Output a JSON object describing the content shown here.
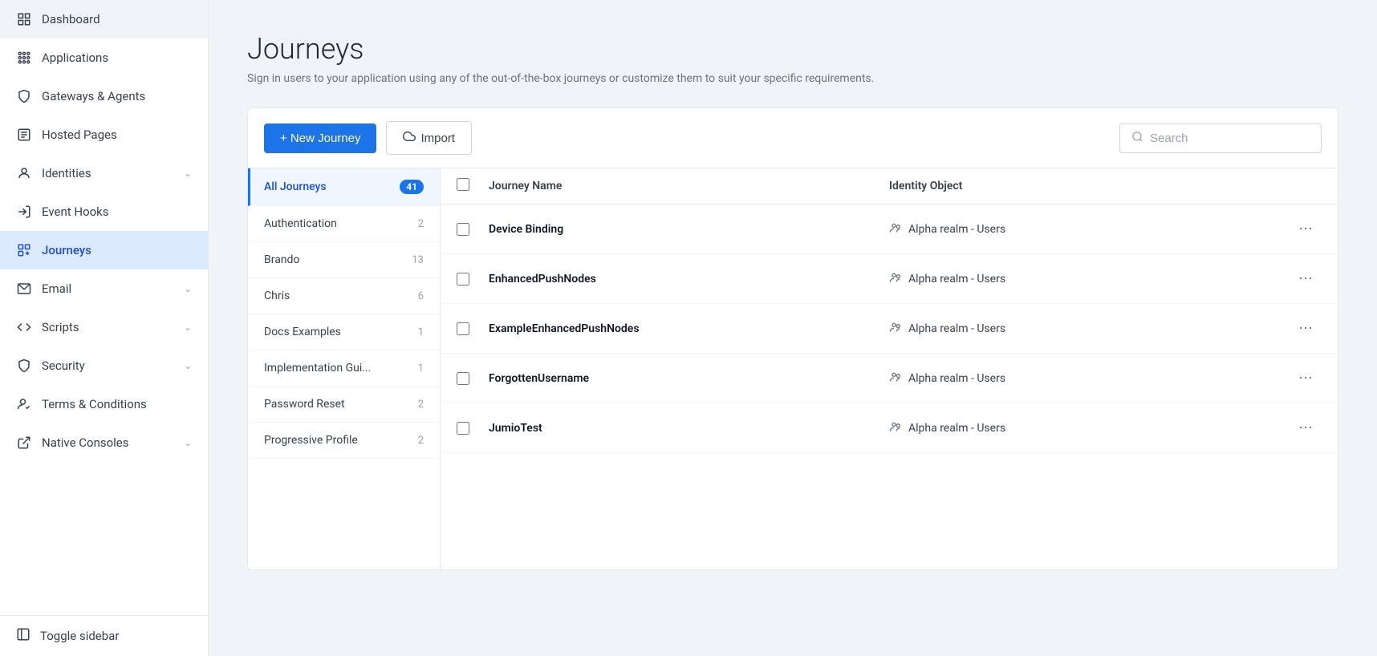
{
  "sidebar": {
    "items": [
      {
        "id": "dashboard",
        "label": "Dashboard",
        "icon": "grid",
        "active": false,
        "hasChevron": false
      },
      {
        "id": "applications",
        "label": "Applications",
        "icon": "apps",
        "active": false,
        "hasChevron": false
      },
      {
        "id": "gateways-agents",
        "label": "Gateways & Agents",
        "icon": "shield-outline",
        "active": false,
        "hasChevron": false
      },
      {
        "id": "hosted-pages",
        "label": "Hosted Pages",
        "icon": "file",
        "active": false,
        "hasChevron": false
      },
      {
        "id": "identities",
        "label": "Identities",
        "icon": "person",
        "active": false,
        "hasChevron": true
      },
      {
        "id": "event-hooks",
        "label": "Event Hooks",
        "icon": "signin",
        "active": false,
        "hasChevron": false
      },
      {
        "id": "journeys",
        "label": "Journeys",
        "icon": "journey",
        "active": true,
        "hasChevron": false
      },
      {
        "id": "email",
        "label": "Email",
        "icon": "email",
        "active": false,
        "hasChevron": true
      },
      {
        "id": "scripts",
        "label": "Scripts",
        "icon": "code",
        "active": false,
        "hasChevron": true
      },
      {
        "id": "security",
        "label": "Security",
        "icon": "shield",
        "active": false,
        "hasChevron": true
      },
      {
        "id": "terms-conditions",
        "label": "Terms & Conditions",
        "icon": "person-check",
        "active": false,
        "hasChevron": false
      },
      {
        "id": "native-consoles",
        "label": "Native Consoles",
        "icon": "external",
        "active": false,
        "hasChevron": true
      }
    ],
    "toggle_label": "Toggle sidebar"
  },
  "page": {
    "title": "Journeys",
    "subtitle": "Sign in users to your application using any of the out-of-the-box journeys or customize them to suit your specific requirements."
  },
  "toolbar": {
    "new_journey_label": "+ New Journey",
    "import_label": "Import",
    "search_placeholder": "Search"
  },
  "journey_categories": [
    {
      "id": "all",
      "label": "All Journeys",
      "count": 41,
      "showBadge": true,
      "active": true
    },
    {
      "id": "authentication",
      "label": "Authentication",
      "count": 2,
      "showBadge": false,
      "active": false
    },
    {
      "id": "brando",
      "label": "Brando",
      "count": 13,
      "showBadge": false,
      "active": false
    },
    {
      "id": "chris",
      "label": "Chris",
      "count": 6,
      "showBadge": false,
      "active": false
    },
    {
      "id": "docs-examples",
      "label": "Docs Examples",
      "count": 1,
      "showBadge": false,
      "active": false
    },
    {
      "id": "implementation-guide",
      "label": "Implementation Gui...",
      "count": 1,
      "showBadge": false,
      "active": false
    },
    {
      "id": "password-reset",
      "label": "Password Reset",
      "count": 2,
      "showBadge": false,
      "active": false
    },
    {
      "id": "progressive-profile",
      "label": "Progressive Profile",
      "count": 2,
      "showBadge": false,
      "active": false
    }
  ],
  "table": {
    "headers": {
      "journey_name": "Journey Name",
      "identity_object": "Identity Object"
    },
    "rows": [
      {
        "id": "device-binding",
        "name": "Device Binding",
        "identity": "Alpha realm - Users"
      },
      {
        "id": "enhanced-push-nodes",
        "name": "EnhancedPushNodes",
        "identity": "Alpha realm - Users"
      },
      {
        "id": "example-enhanced-push-nodes",
        "name": "ExampleEnhancedPushNodes",
        "identity": "Alpha realm - Users"
      },
      {
        "id": "forgotten-username",
        "name": "ForgottenUsername",
        "identity": "Alpha realm - Users"
      },
      {
        "id": "jumitotest",
        "name": "JumioTest",
        "identity": "Alpha realm - Users"
      }
    ]
  }
}
